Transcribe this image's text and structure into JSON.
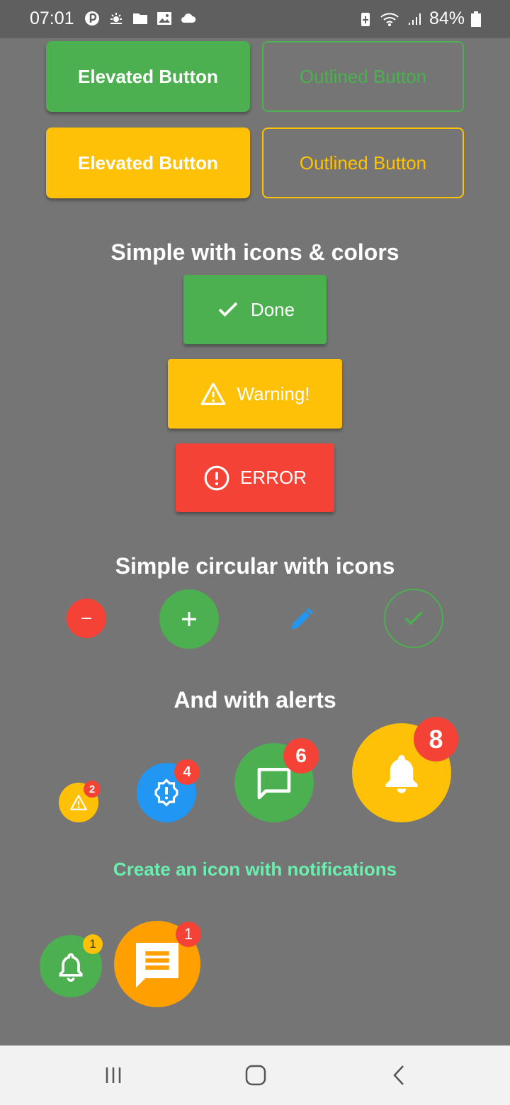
{
  "status_bar": {
    "time": "07:01",
    "battery_percent": "84%",
    "left_icons": [
      "app-icon",
      "weather-icon",
      "folder-icon",
      "image-icon",
      "cloud-icon"
    ],
    "right_icons": [
      "battery-saver-icon",
      "wifi-icon",
      "signal-icon",
      "battery-icon"
    ]
  },
  "top_buttons": [
    {
      "label": "Elevated Button",
      "style": "elevated",
      "color": "#4CAF50"
    },
    {
      "label": "Outlined Button",
      "style": "outlined",
      "color": "#4CAF50"
    },
    {
      "label": "Elevated Button",
      "style": "elevated",
      "color": "#FFC107"
    },
    {
      "label": "Outlined Button",
      "style": "outlined",
      "color": "#FFC107"
    }
  ],
  "section_icons_colors": {
    "title": "Simple with icons & colors",
    "buttons": [
      {
        "label": "Done",
        "icon": "check-icon",
        "color": "#4CAF50"
      },
      {
        "label": "Warning!",
        "icon": "warning-icon",
        "color": "#FFC107"
      },
      {
        "label": "ERROR",
        "icon": "error-icon",
        "color": "#F44336"
      }
    ]
  },
  "section_circular": {
    "title": "Simple circular with icons",
    "buttons": [
      {
        "icon": "minus-icon",
        "color": "#F44336"
      },
      {
        "icon": "plus-icon",
        "color": "#4CAF50"
      },
      {
        "icon": "edit-icon",
        "color": "#2196F3"
      },
      {
        "icon": "check-icon",
        "color": "#4CAF50"
      }
    ]
  },
  "section_alerts": {
    "title": "And with alerts",
    "items": [
      {
        "icon": "warning-icon",
        "color": "#FFC107",
        "badge": "2"
      },
      {
        "icon": "settings-alert-icon",
        "color": "#2196F3",
        "badge": "4"
      },
      {
        "icon": "chat-icon",
        "color": "#4CAF50",
        "badge": "6"
      },
      {
        "icon": "bell-icon",
        "color": "#FFC107",
        "badge": "8"
      }
    ]
  },
  "notifications": {
    "label": "Create an icon with notifications",
    "items": [
      {
        "icon": "bell-outline-icon",
        "color": "#4CAF50",
        "badge": "1",
        "badge_color": "#FFC107"
      },
      {
        "icon": "message-icon",
        "color": "#FFA000",
        "badge": "1",
        "badge_color": "#F44336"
      }
    ]
  },
  "nav_bar": {
    "items": [
      "recents-icon",
      "home-icon",
      "back-icon"
    ]
  },
  "colors": {
    "background": "#757575",
    "green": "#4CAF50",
    "amber": "#FFC107",
    "red": "#F44336",
    "blue": "#2196F3",
    "link_green": "#69F0AE"
  }
}
